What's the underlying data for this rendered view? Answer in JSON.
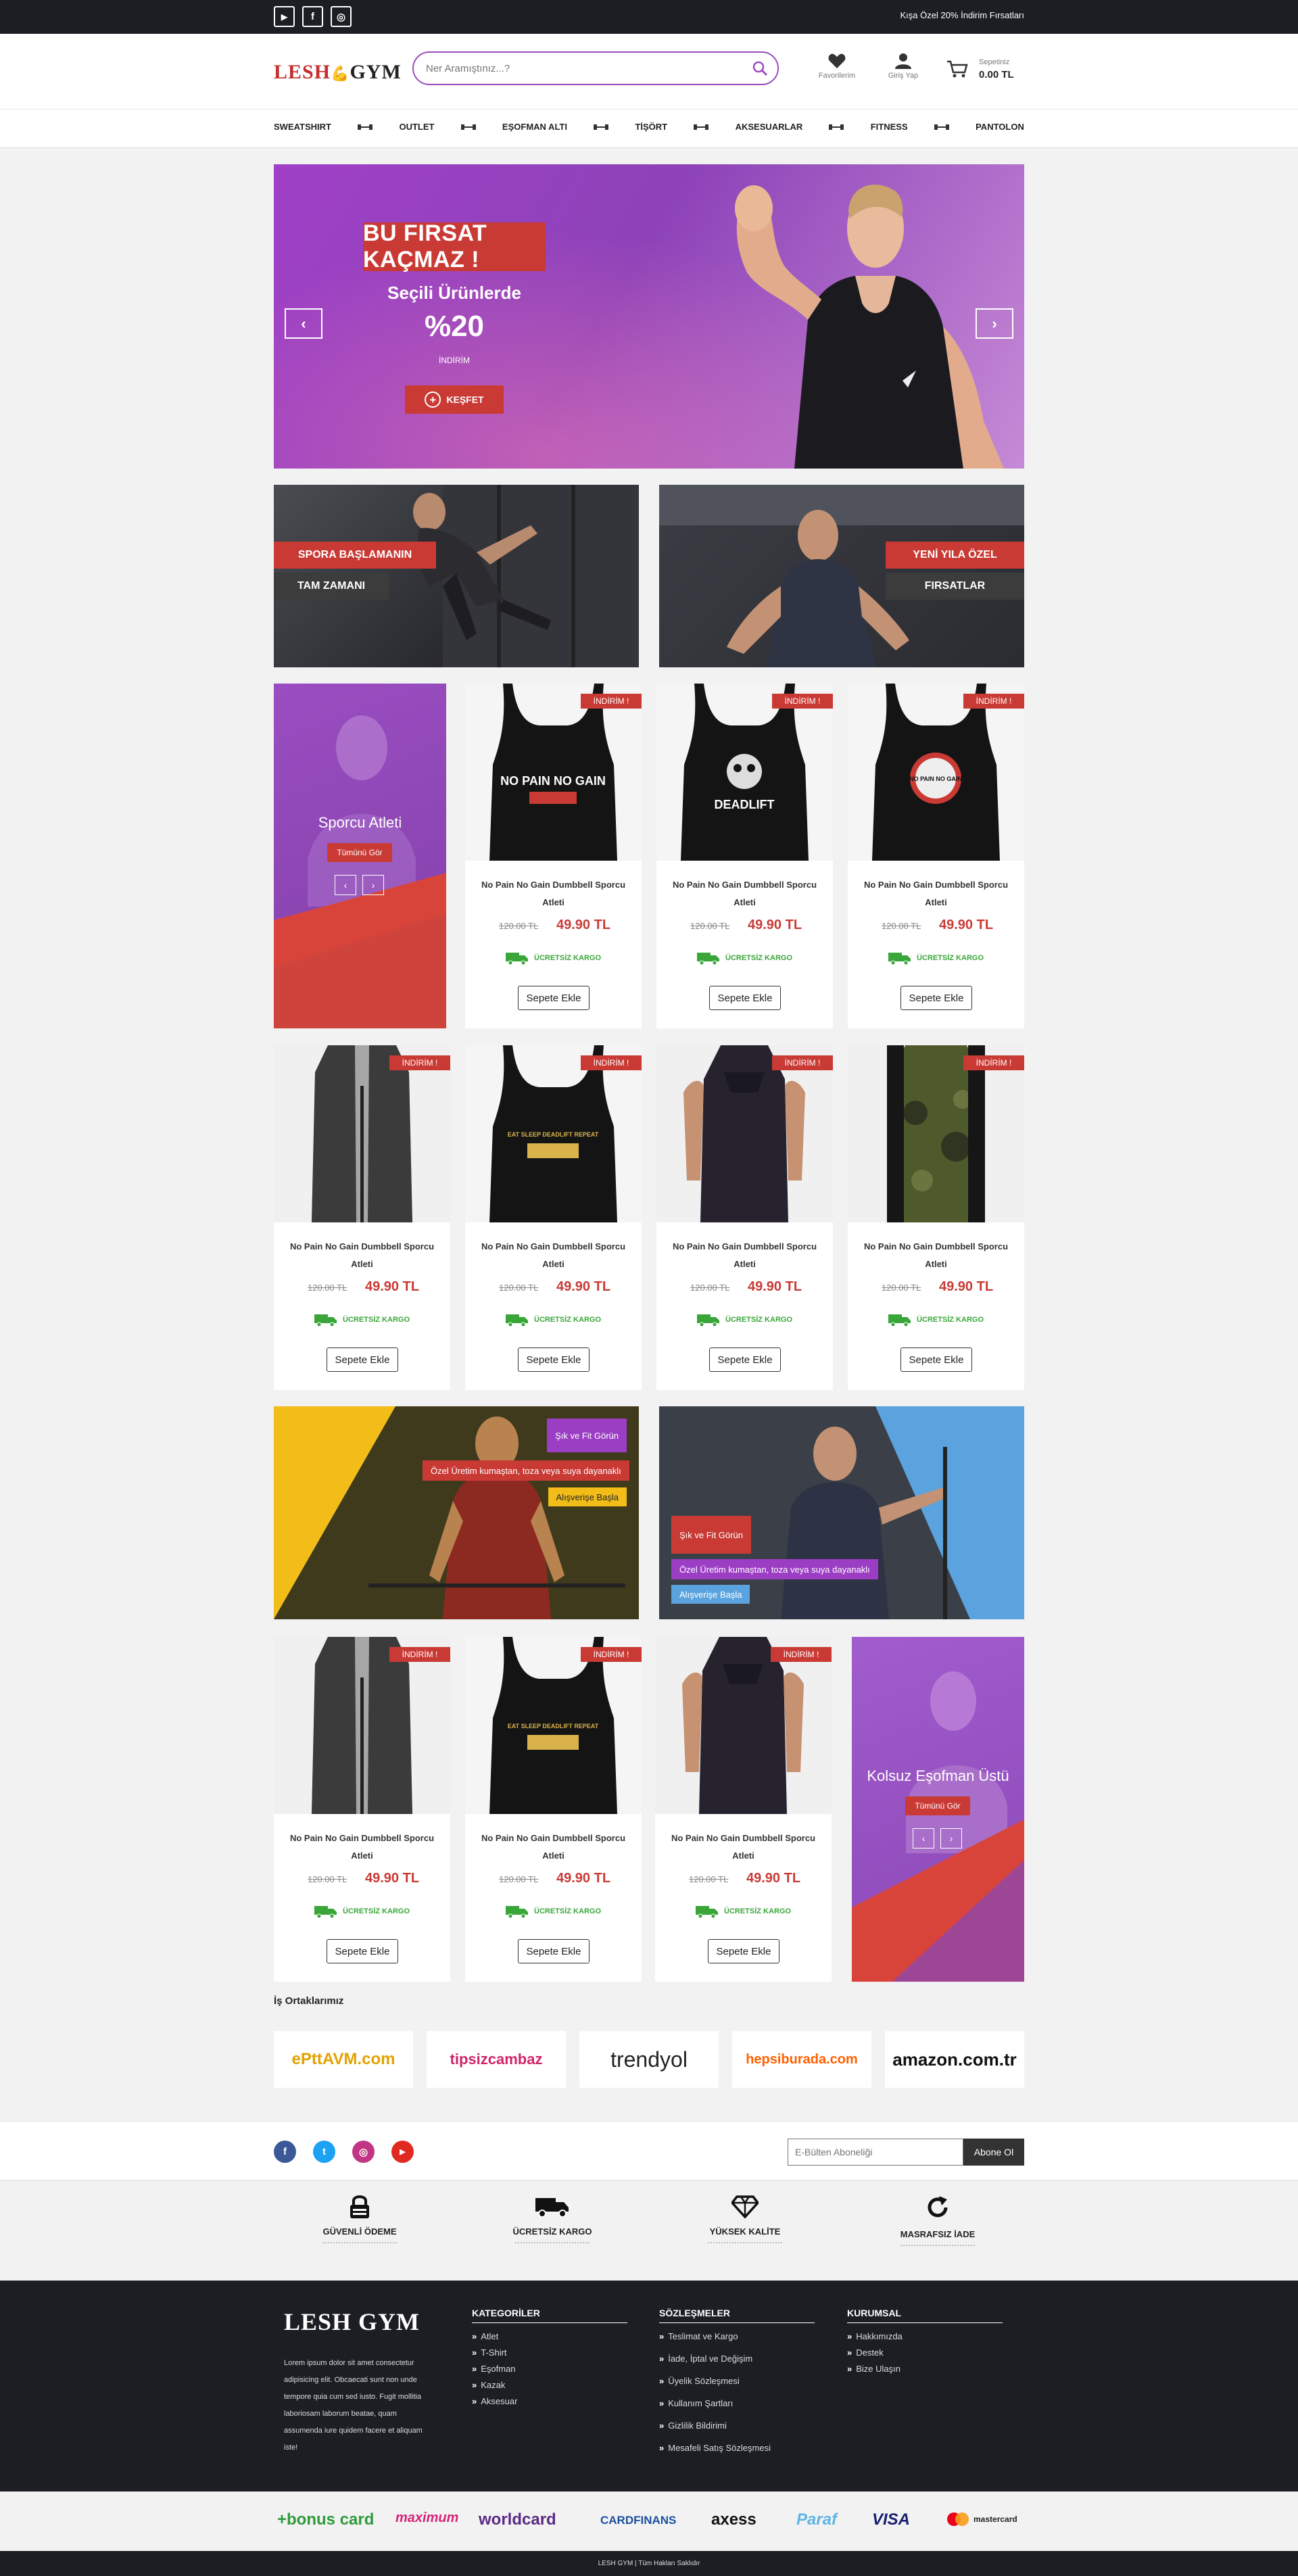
{
  "topbar": {
    "social": [
      "youtube-icon",
      "facebook-icon",
      "instagram-icon"
    ],
    "social_glyphs": [
      "▶",
      "f",
      "◎"
    ],
    "note": "Kışa Özel 20% İndirim Fırsatları"
  },
  "header": {
    "logo_left": "LESH",
    "logo_right": "GYM",
    "search_placeholder": "Ner Aramıştınız...?",
    "favorites": "Favorilerim",
    "login": "Giriş Yap",
    "cart_label": "Sepetiniz",
    "cart_amount": "0.00 TL"
  },
  "nav": [
    "SWEATSHIRT",
    "OUTLET",
    "EŞOFMAN ALTI",
    "TİŞÖRT",
    "AKSESUARLAR",
    "FITNESS",
    "PANTOLON"
  ],
  "hero": {
    "badge": "BU FIRSAT KAÇMAZ !",
    "subtitle": "Seçili Ürünlerde",
    "percent": "%20",
    "small": "İNDİRİM",
    "button": "KEŞFET",
    "prev": "‹",
    "next": "›"
  },
  "banners": [
    {
      "line1": "SPORA BAŞLAMANIN",
      "line2": "TAM ZAMANI"
    },
    {
      "line1": "YENİ YILA ÖZEL",
      "line2": "FIRSATLAR"
    }
  ],
  "category_cards": [
    {
      "title": "Sporcu Atleti",
      "button": "Tümünü Gör"
    },
    {
      "title": "Kolsuz Eşofman Üstü",
      "button": "Tümünü Gör"
    }
  ],
  "product": {
    "tag": "İNDİRİM !",
    "name": "No Pain No Gain Dumbbell Sporcu Atleti",
    "old_price": "120.00 TL",
    "new_price": "49.90 TL",
    "shipping": "ÜCRETSİZ KARGO",
    "add_to_cart": "Sepete Ekle",
    "print_texts": [
      "NO PAIN NO GAIN",
      "DEADLIFT",
      "NO PAIN NO GAIN",
      "EAT SLEEP DEADLIFT REPEAT"
    ]
  },
  "promos": [
    {
      "tag": "Şık ve Fit Görün",
      "text": "Özel Üretim kumaştan, toza veya suya dayanaklı",
      "button": "Alışverişe Başla"
    },
    {
      "tag": "Şık ve Fit Görün",
      "text": "Özel Üretim kumaştan, toza veya suya dayanaklı",
      "button": "Alışverişe Başla"
    }
  ],
  "partners": {
    "title": "İş Ortaklarımız",
    "items": [
      "ePttAVM.com",
      "tipsizcambaz",
      "trendyol",
      "hepsiburada.com",
      "amazon.com.tr"
    ],
    "colors": [
      "#e2a200",
      "#d0246b",
      "#222222",
      "#ff6000",
      "#111111"
    ]
  },
  "newsletter": {
    "social": [
      "facebook-icon",
      "twitter-icon",
      "instagram-icon",
      "youtube-icon"
    ],
    "social_glyphs": [
      "f",
      "t",
      "◎",
      "▶"
    ],
    "social_colors": [
      "#3b5998",
      "#1da1f2",
      "#c13584",
      "#e02a20"
    ],
    "placeholder": "E-Bülten Aboneliği",
    "button": "Abone Ol"
  },
  "features": [
    "GÜVENLİ ÖDEME",
    "ÜCRETSİZ KARGO",
    "YÜKSEK KALİTE",
    "MASRAFSIZ İADE"
  ],
  "footer": {
    "logo": "LESH GYM",
    "about": "Lorem ipsum dolor sit amet consectetur adipisicing elit. Obcaecati sunt non unde tempore quia cum sed iusto. Fugit mollitia laboriosam laborum beatae, quam assumenda iure quidem facere et aliquam iste!",
    "columns": [
      {
        "title": "KATEGORİLER",
        "items": [
          "Atlet",
          "T-Shirt",
          "Eşofman",
          "Kazak",
          "Aksesuar"
        ]
      },
      {
        "title": "SÖZLEŞMELER",
        "items": [
          "Teslimat ve Kargo",
          "İade, İptal ve Değişim",
          "Üyelik Sözleşmesi",
          "Kullanım Şartları",
          "Gizlilik Bildirimi",
          "Mesafeli Satış Sözleşmesi"
        ]
      },
      {
        "title": "KURUMSAL",
        "items": [
          "Hakkımızda",
          "Destek",
          "Bize Ulaşın"
        ]
      }
    ]
  },
  "card_logos": {
    "items": [
      "+bonus card",
      "maximum",
      "worldcard",
      "CARDFINANS",
      "axess",
      "Paraf",
      "VISA",
      "mastercard"
    ],
    "colors": [
      "#2f9b3c",
      "#d6237a",
      "#5b2a86",
      "#1a4fa0",
      "#111111",
      "#5fb7e5",
      "#1a1f71",
      "#222222"
    ]
  },
  "copyright": "LESH GYM | Tüm Hakları Saklıdır"
}
